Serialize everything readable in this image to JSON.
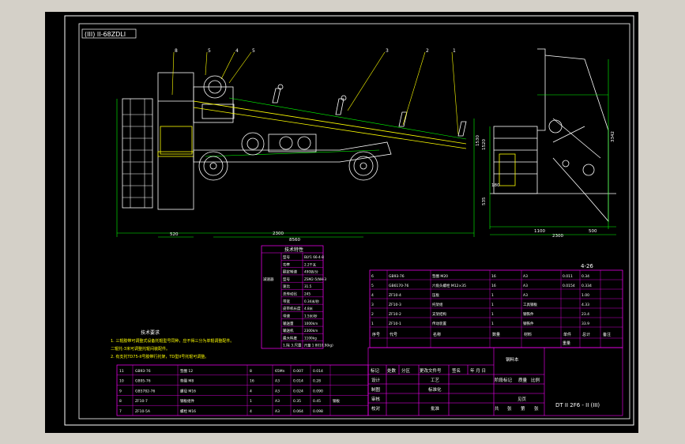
{
  "drawing": {
    "view_title": "(III) II-68ZDLI",
    "sheet_no": "4-26",
    "colors": {
      "paper": "#000000",
      "frame": "#ffffff",
      "table": "#ff00ff",
      "machine": "#ffffff",
      "dims": "#00ff00",
      "leaders": "#ffff00",
      "text": "#ffffff"
    },
    "callouts": [
      "8",
      "5",
      "4",
      "5",
      "3",
      "2",
      "1"
    ],
    "dims_side": [
      "520",
      "2300",
      "8560",
      "1530"
    ],
    "dims_end": [
      "1100",
      "2300",
      "500",
      "3342",
      "535",
      "180",
      "1520"
    ]
  },
  "tech_table": {
    "title": "技术特性",
    "rows": [
      [
        "",
        "型号",
        "BLY1 66-4-8"
      ],
      [
        "",
        "功率",
        "2.2千瓦"
      ],
      [
        "",
        "额定转速",
        "490转/分"
      ],
      [
        "减速器",
        "型号",
        "ZSM2-5(NH-3"
      ],
      [
        "",
        "速比",
        "31.5"
      ],
      [
        "",
        "总传动比",
        "245"
      ],
      [
        "",
        "带宽",
        "0.34米/秒"
      ],
      [
        "",
        "皮带机长度",
        "4.8米"
      ],
      [
        "",
        "带速",
        "1.5米/秒"
      ],
      [
        "",
        "输送量",
        "1000km"
      ],
      [
        "",
        "输送机",
        "2300km"
      ],
      [
        "",
        "最大料度",
        "1100kg"
      ],
      [
        "",
        "1.除 3.尺量",
        "尺量 1 8010.9(kg)"
      ]
    ]
  },
  "tech_notes": {
    "title": "技术要求",
    "lines": [
      "1. 三辊胶带可调整式设备托辊型号同种，应不得三分为单辊调整配件。",
      "二辊托-3米可调整托辊间装配件。",
      "2. 有支托TD75-II号胶带行托架，TD型II号托辊可调整。"
    ]
  },
  "parts_right": {
    "rows": [
      [
        "6",
        "GB93-76",
        "垫圈 M20",
        "16",
        "A3",
        "0.011",
        "0.34",
        ""
      ],
      [
        "5",
        "GB6170-76",
        "六角头螺栓 M12×35",
        "16",
        "A3",
        "0.0154",
        "0.334",
        ""
      ],
      [
        "4",
        "ZF10-4",
        "压板",
        "1",
        "A3",
        "",
        "1.00",
        ""
      ],
      [
        "3",
        "ZF10-3",
        "托架组",
        "1",
        "工具钢板",
        "",
        "4.33",
        ""
      ],
      [
        "2",
        "ZF10-2",
        "支架结构",
        "1",
        "钢铁件",
        "",
        "23.4",
        ""
      ],
      [
        "1",
        "ZF10-1",
        "传动装置",
        "1",
        "钢铁件",
        "",
        "33.9",
        ""
      ]
    ],
    "header": [
      "序号",
      "代号",
      "名称",
      "数量",
      "材料",
      "单件",
      "总计",
      "备注"
    ],
    "header_sub": [
      "重量"
    ]
  },
  "parts_left": {
    "rows": [
      [
        "11",
        "GB93-76",
        "垫圈 12",
        "8",
        "65Mn",
        "0.007",
        "0.014",
        ""
      ],
      [
        "10",
        "GB95-76",
        "垫圈 M8",
        "16",
        "A3",
        "0.014",
        "0.28",
        ""
      ],
      [
        "9",
        "GB5782-76",
        "螺母 M16",
        "4",
        "A3",
        "0.024",
        "0.090",
        ""
      ],
      [
        "8",
        "ZF10-7",
        "钢板组件",
        "1",
        "A3",
        "0.35",
        "0.45",
        "钢板"
      ],
      [
        "7",
        "ZF10-5A",
        "螺栓 M16",
        "4",
        "A3",
        "0.064",
        "0.098",
        ""
      ]
    ]
  },
  "title_block": {
    "material": "钢料本",
    "drawing_no": "DT II 2F6 - II (III)",
    "row_labels": [
      "标记",
      "处数",
      "分区",
      "更改文件号",
      "签名",
      "年 月 日"
    ],
    "left_labels": [
      "设计",
      "制图",
      "审核",
      "校对"
    ],
    "mid_labels": [
      "工艺",
      "标准化",
      "",
      "批准"
    ],
    "stage_labels": [
      "阶段标记",
      "质量",
      "比例"
    ],
    "bottom_labels": [
      "共",
      "张",
      "第",
      "张"
    ],
    "view_label": "见页"
  }
}
